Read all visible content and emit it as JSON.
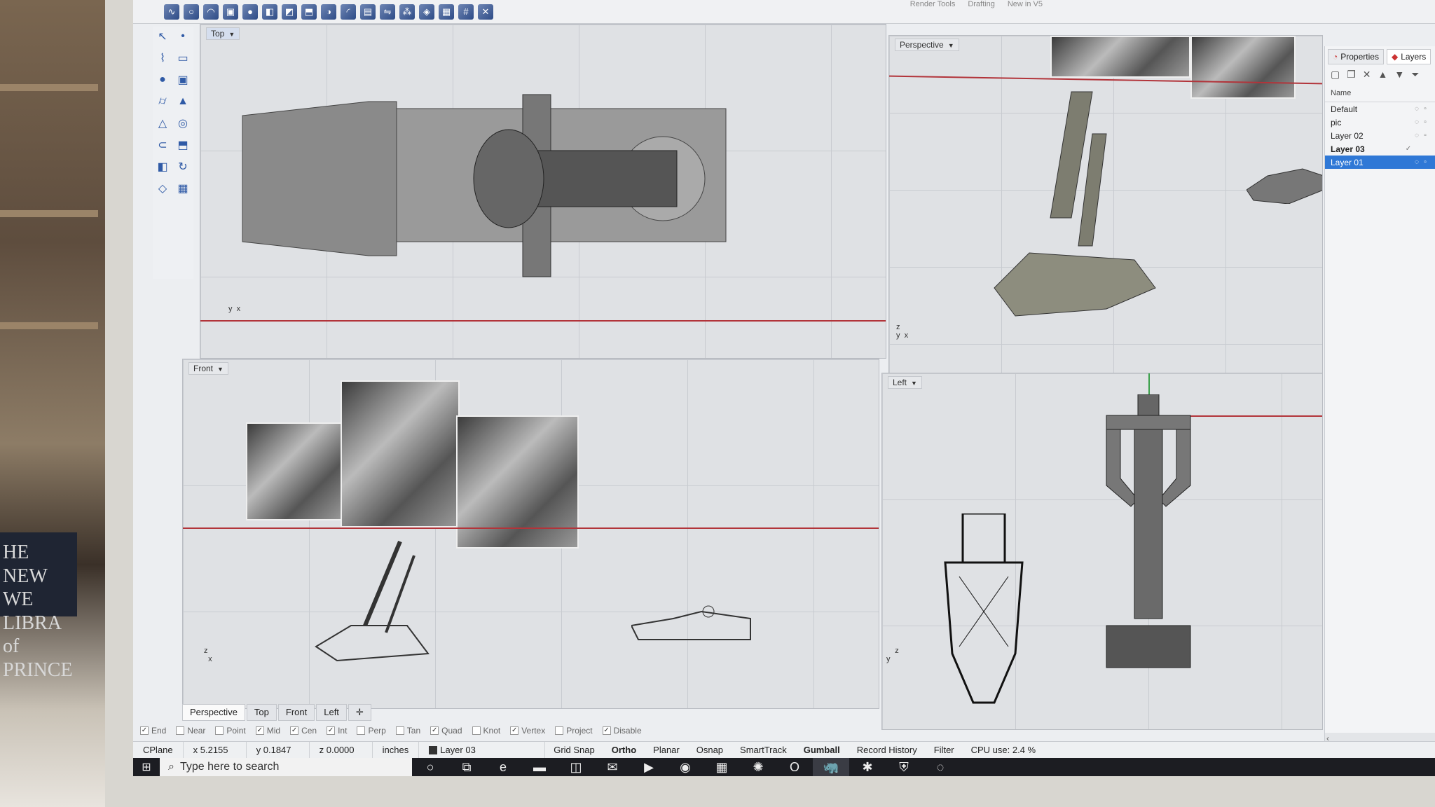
{
  "menu_tabs": [
    "Render Tools",
    "Drafting",
    "New in V5"
  ],
  "toolbar_icons": [
    "curve-icon",
    "circle-icon",
    "arc-icon",
    "box-icon",
    "sphere-icon",
    "loft-icon",
    "sweep-icon",
    "extrude-icon",
    "boolean-icon",
    "fillet-icon",
    "shell-icon",
    "mirror-icon",
    "array-icon",
    "render-icon",
    "mesh-icon",
    "grid-icon",
    "close-icon"
  ],
  "left_tools": [
    "select-icon",
    "point-icon",
    "polyline-icon",
    "rectangle-icon",
    "sphere-icon",
    "box-icon",
    "cylinder-icon",
    "cone-icon",
    "pyramid-icon",
    "torus-icon",
    "pipe-icon",
    "extrude-icon",
    "loft-icon",
    "revolve-icon",
    "surface-icon",
    "mesh-icon"
  ],
  "viewports": {
    "top": {
      "label": "Top"
    },
    "perspective": {
      "label": "Perspective"
    },
    "front": {
      "label": "Front"
    },
    "left": {
      "label": "Left"
    }
  },
  "axes": {
    "x": "x",
    "y": "y",
    "z": "z"
  },
  "panel": {
    "tab_properties": "Properties",
    "tab_layers": "Layers",
    "column_name": "Name",
    "layers": [
      {
        "name": "Default",
        "current": false,
        "selected": false
      },
      {
        "name": "pic",
        "current": false,
        "selected": false
      },
      {
        "name": "Layer 02",
        "current": false,
        "selected": false
      },
      {
        "name": "Layer 03",
        "current": true,
        "selected": false
      },
      {
        "name": "Layer 01",
        "current": false,
        "selected": true
      }
    ]
  },
  "viewport_tabs": [
    "Perspective",
    "Top",
    "Front",
    "Left"
  ],
  "osnaps": [
    {
      "label": "End",
      "checked": true
    },
    {
      "label": "Near",
      "checked": false
    },
    {
      "label": "Point",
      "checked": false
    },
    {
      "label": "Mid",
      "checked": true
    },
    {
      "label": "Cen",
      "checked": true
    },
    {
      "label": "Int",
      "checked": true
    },
    {
      "label": "Perp",
      "checked": false
    },
    {
      "label": "Tan",
      "checked": false
    },
    {
      "label": "Quad",
      "checked": true
    },
    {
      "label": "Knot",
      "checked": false
    },
    {
      "label": "Vertex",
      "checked": true
    },
    {
      "label": "Project",
      "checked": false
    },
    {
      "label": "Disable",
      "checked": true
    }
  ],
  "status": {
    "cplane": "CPlane",
    "x": "x 5.2155",
    "y": "y 0.1847",
    "z": "z 0.0000",
    "units": "inches",
    "layer": "Layer 03",
    "buttons": [
      "Grid Snap",
      "Ortho",
      "Planar",
      "Osnap",
      "SmartTrack",
      "Gumball",
      "Record History",
      "Filter"
    ],
    "bold_buttons": [
      "Ortho",
      "Gumball"
    ],
    "cpu": "CPU use: 2.4 %"
  },
  "taskbar": {
    "search_placeholder": "Type here to search",
    "apps": [
      "cortana-icon",
      "task-view-icon",
      "edge-icon",
      "file-explorer-icon",
      "store-icon",
      "mail-icon",
      "media-icon",
      "chrome-icon",
      "calculator-icon",
      "gear-icon",
      "outlook-icon",
      "rhino-icon",
      "slack-icon",
      "security-icon",
      "app-icon"
    ]
  },
  "book_text": "HE NEW WE\nLIBRA\nof\nPRINCE"
}
